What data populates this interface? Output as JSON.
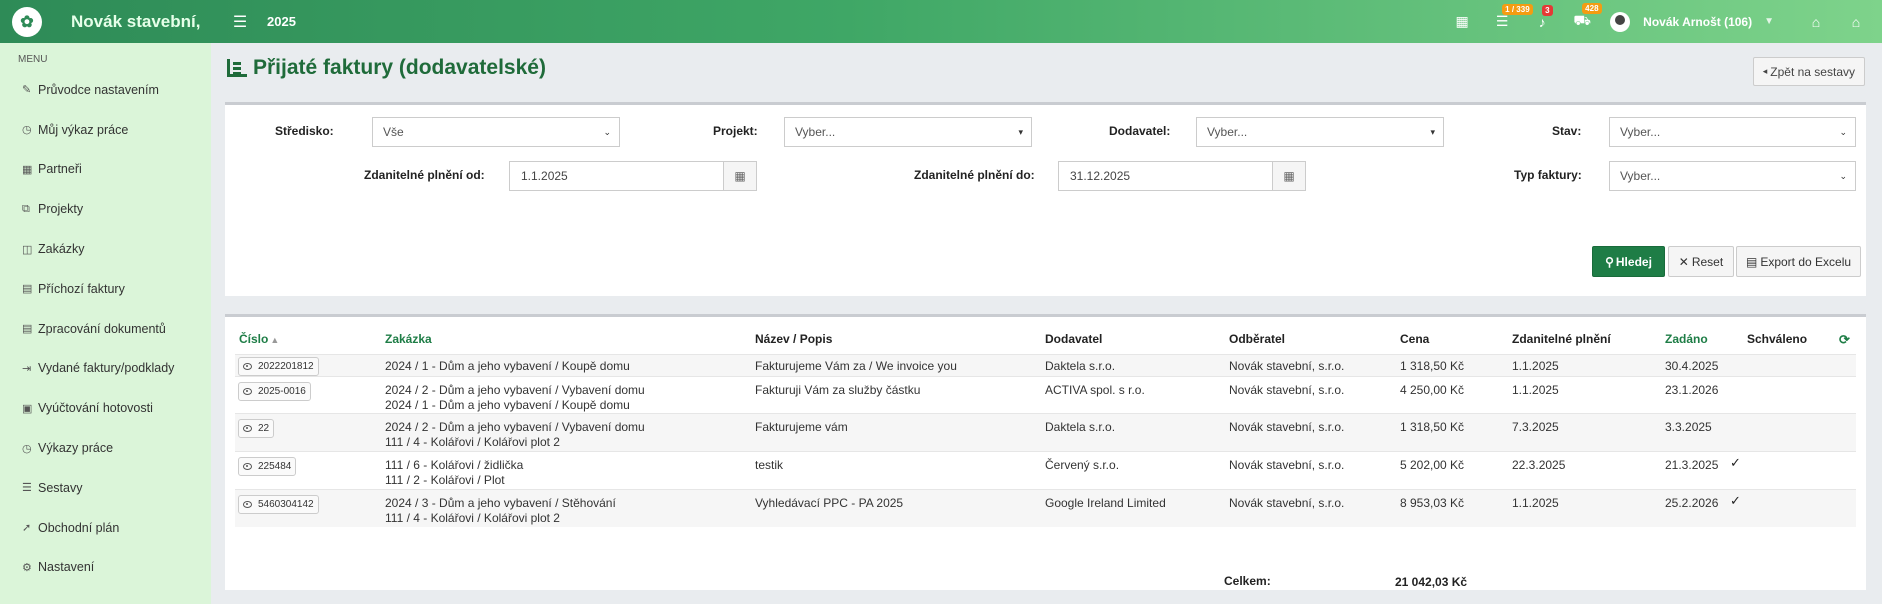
{
  "topbar": {
    "brand": "Novák stavební,",
    "year": "2025",
    "tasks_badge": "1 / 339",
    "notif_badge": "3",
    "car_badge": "428",
    "user_name": "Novák Arnošt (106)"
  },
  "sidebar": {
    "menu_title": "MENU",
    "items": [
      {
        "label": "Průvodce nastavením",
        "icon": "✎"
      },
      {
        "label": "Můj výkaz práce",
        "icon": "◷"
      },
      {
        "label": "Partneři",
        "icon": "▦"
      },
      {
        "label": "Projekty",
        "icon": "⧉"
      },
      {
        "label": "Zakázky",
        "icon": "◫"
      },
      {
        "label": "Příchozí faktury",
        "icon": "▤"
      },
      {
        "label": "Zpracování dokumentů",
        "icon": "▤"
      },
      {
        "label": "Vydané faktury/podklady",
        "icon": "⇥"
      },
      {
        "label": "Vyúčtování hotovosti",
        "icon": "▣"
      },
      {
        "label": "Výkazy práce",
        "icon": "◷"
      },
      {
        "label": "Sestavy",
        "icon": "☰"
      },
      {
        "label": "Obchodní plán",
        "icon": "➚"
      },
      {
        "label": "Nastavení",
        "icon": "⚙"
      }
    ]
  },
  "page": {
    "title": "Přijaté faktury (dodavatelské)",
    "back_label": "Zpět na sestavy"
  },
  "filters": {
    "stredisko_label": "Středisko:",
    "stredisko_value": "Vše",
    "projekt_label": "Projekt:",
    "projekt_value": "Vyber...",
    "dodavatel_label": "Dodavatel:",
    "dodavatel_value": "Vyber...",
    "stav_label": "Stav:",
    "stav_value": "Vyber...",
    "od_label": "Zdanitelné plnění od:",
    "od_value": "1.1.2025",
    "do_label": "Zdanitelné plnění do:",
    "do_value": "31.12.2025",
    "typ_label": "Typ faktury:",
    "typ_value": "Vyber...",
    "search_label": "Hledej",
    "reset_label": "Reset",
    "export_label": "Export do Excelu"
  },
  "table": {
    "headers": {
      "cislo": "Číslo",
      "zakazka": "Zakázka",
      "nazev": "Název / Popis",
      "dodavatel": "Dodavatel",
      "odberatel": "Odběratel",
      "cena": "Cena",
      "plneni": "Zdanitelné plnění",
      "zadano": "Zadáno",
      "schvaleno": "Schváleno"
    },
    "rows": [
      {
        "cislo": "2022201812",
        "zakazka1": "2024 / 1 - Dům a jeho vybavení / Koupě domu",
        "zakazka2": "",
        "nazev": "Fakturujeme Vám za / We invoice you",
        "dodavatel": "Daktela s.r.o.",
        "odberatel": "Novák stavební, s.r.o.",
        "cena": "1 318,50 Kč",
        "plneni": "1.1.2025",
        "zadano": "30.4.2025",
        "schvaleno": ""
      },
      {
        "cislo": "2025-0016",
        "zakazka1": "2024 / 2 - Dům a jeho vybavení / Vybavení domu",
        "zakazka2": "2024 / 1 - Dům a jeho vybavení / Koupě domu",
        "nazev": "Fakturuji Vám za služby částku",
        "dodavatel": "ACTIVA spol. s r.o.",
        "odberatel": "Novák stavební, s.r.o.",
        "cena": "4 250,00 Kč",
        "plneni": "1.1.2025",
        "zadano": "23.1.2026",
        "schvaleno": ""
      },
      {
        "cislo": "22",
        "zakazka1": "2024 / 2 - Dům a jeho vybavení / Vybavení domu",
        "zakazka2": "111 / 4 - Kolářovi / Kolářovi plot 2",
        "nazev": "Fakturujeme vám",
        "dodavatel": "Daktela s.r.o.",
        "odberatel": "Novák stavební, s.r.o.",
        "cena": "1 318,50 Kč",
        "plneni": "7.3.2025",
        "zadano": "3.3.2025",
        "schvaleno": ""
      },
      {
        "cislo": "225484",
        "zakazka1": "111 / 6 - Kolářovi / židlička",
        "zakazka2": "111 / 2 - Kolářovi / Plot",
        "nazev": "testik",
        "dodavatel": "Červený s.r.o.",
        "odberatel": "Novák stavební, s.r.o.",
        "cena": "5 202,00 Kč",
        "plneni": "22.3.2025",
        "zadano": "21.3.2025",
        "schvaleno": "✓"
      },
      {
        "cislo": "5460304142",
        "zakazka1": "2024 / 3 - Dům a jeho vybavení / Stěhování",
        "zakazka2": "111 / 4 - Kolářovi / Kolářovi plot 2",
        "nazev": "Vyhledávací PPC - PA 2025",
        "dodavatel": "Google Ireland Limited",
        "odberatel": "Novák stavební, s.r.o.",
        "cena": "8 953,03 Kč",
        "plneni": "1.1.2025",
        "zadano": "25.2.2026",
        "schvaleno": "✓"
      }
    ],
    "total_label": "Celkem:",
    "total_value": "21 042,03 Kč"
  }
}
